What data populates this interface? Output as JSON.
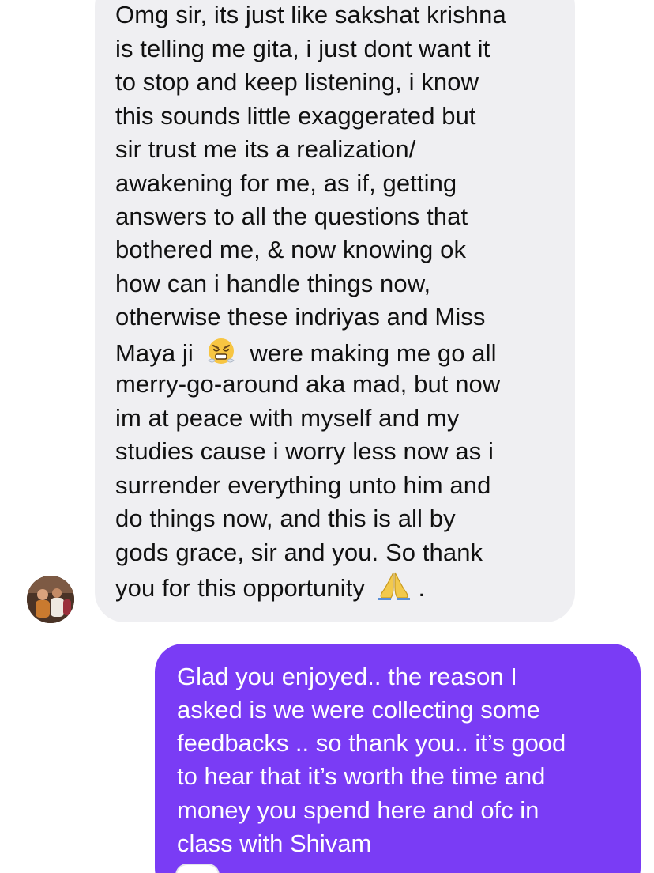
{
  "incoming": {
    "lines": [
      "Omg sir, its just like sakshat krishna",
      "is telling me gita, i just dont want it",
      "to stop and keep listening,  i know",
      "this sounds little exaggerated  but",
      "sir trust me its a realization/",
      "awakening for me, as if, getting",
      "answers to all the questions that",
      "bothered me, & now knowing ok",
      "how can i handle things now,",
      "otherwise these indriyas and Miss",
      "were making me go all",
      "merry-go-around aka mad, but now",
      "im at peace with myself and my",
      "studies cause i worry less now as i",
      "surrender everything unto him and",
      "do things now, and this is all by",
      "gods grace, sir and you. So thank",
      "you for this opportunity"
    ],
    "maya_prefix": "Maya ji",
    "end_punct": ".",
    "emoji_1": "steam-from-nose-face-emoji",
    "emoji_2": "folded-hands-emoji",
    "bubble_color": "#efeff2"
  },
  "outgoing": {
    "lines": [
      "Glad you enjoyed.. the reason I",
      "asked is we were collecting some",
      "feedbacks .. so thank you.. it’s good",
      "to hear that it’s worth the time and",
      "money you spend here and ofc in",
      "class with Shivam"
    ],
    "bubble_color": "#7a3cf5"
  },
  "avatar": "sender-avatar"
}
